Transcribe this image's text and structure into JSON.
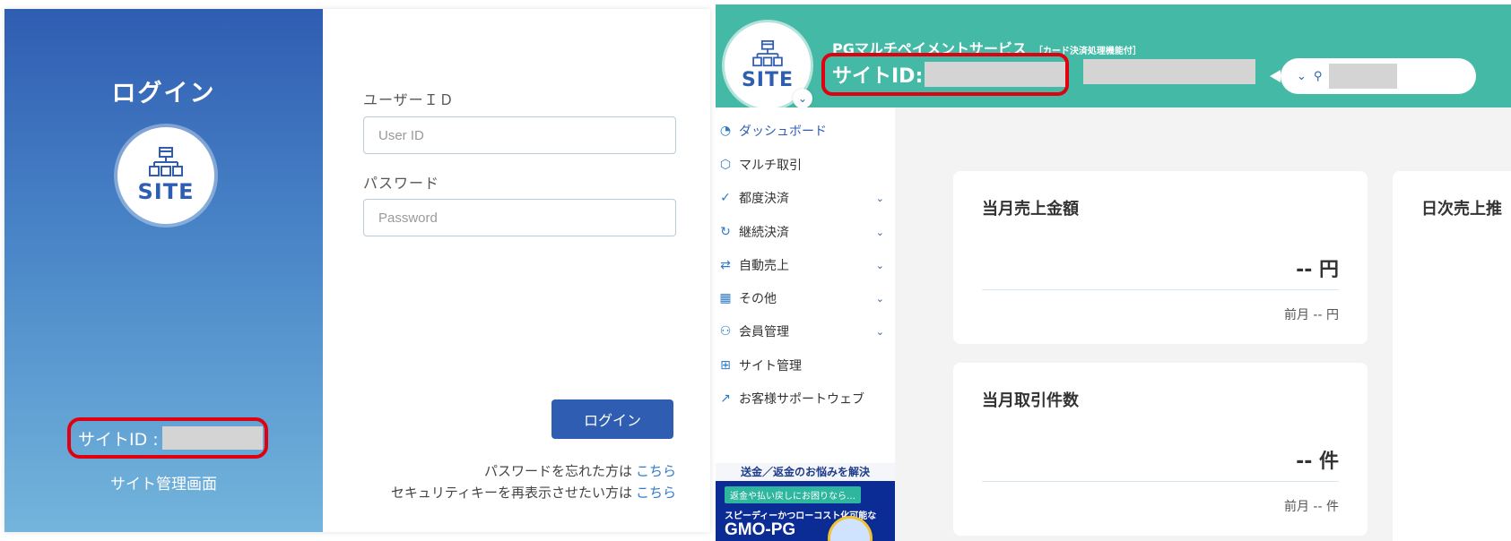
{
  "login": {
    "heading": "ログイン",
    "logo_text": "SITE",
    "site_id_label": "サイトID :",
    "subtitle": "サイト管理画面",
    "user_id_label": "ユーザーＩＤ",
    "user_id_placeholder": "User ID",
    "password_label": "パスワード",
    "password_placeholder": "Password",
    "login_button": "ログイン",
    "forgot_text": "パスワードを忘れた方は",
    "forgot_link": "こちら",
    "security_text": "セキュリティキーを再表示させたい方は",
    "security_link": "こちら"
  },
  "header": {
    "logo_text": "SITE",
    "service_name": "PGマルチペイメントサービス",
    "service_note": "［カード決済処理機能付］",
    "site_id_label": "サイトID:"
  },
  "nav": [
    {
      "label": "ダッシュボード",
      "icon": "pie-chart-icon",
      "glyph": "◔"
    },
    {
      "label": "マルチ取引",
      "icon": "cube-icon",
      "glyph": "⬡"
    },
    {
      "label": "都度決済",
      "icon": "check-circle-icon",
      "glyph": "✓"
    },
    {
      "label": "継続決済",
      "icon": "refresh-icon",
      "glyph": "↻"
    },
    {
      "label": "自動売上",
      "icon": "swap-icon",
      "glyph": "⇄"
    },
    {
      "label": "その他",
      "icon": "grid-icon",
      "glyph": "▦"
    },
    {
      "label": "会員管理",
      "icon": "users-icon",
      "glyph": "⚇"
    },
    {
      "label": "サイト管理",
      "icon": "sitemap-icon",
      "glyph": "⊞"
    },
    {
      "label": "お客様サポートウェブ",
      "icon": "external-link-icon",
      "glyph": "↗"
    }
  ],
  "banner": {
    "top": "送金／返金のお悩みを解決",
    "tag": "返金や払い戻しにお困りなら…",
    "line": "スピーディーかつローコスト化可能な",
    "brand": "GMO-PG"
  },
  "cards": {
    "sales": {
      "title": "当月売上金額",
      "value": "-- 円",
      "prev": "前月 -- 円"
    },
    "count": {
      "title": "当月取引件数",
      "value": "-- 件",
      "prev": "前月 -- 件"
    },
    "daily": {
      "title": "日次売上推"
    }
  },
  "colors": {
    "primary": "#2f5db2",
    "header_teal": "#43b9a6",
    "highlight_red": "#e1000f",
    "link": "#2f7bc8"
  }
}
